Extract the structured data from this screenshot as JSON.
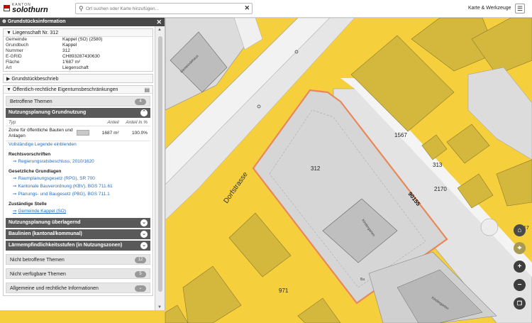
{
  "header": {
    "logo_kanton": "KANTON",
    "logo_name": "solothurn",
    "search_placeholder": "Ort suchen oder Karte hinzufügen...",
    "tools_label": "Karte & Werkzeuge"
  },
  "panel": {
    "title": "Grundstücksinformation",
    "parcel_header": "Liegenschaft Nr. 312",
    "parcel_rows": [
      {
        "k": "Gemeinde",
        "v": "Kappel (SO) (2580)"
      },
      {
        "k": "Grundbuch",
        "v": "Kappel"
      },
      {
        "k": "Nummer",
        "v": "312"
      },
      {
        "k": "E-GRID",
        "v": "CH893287430630"
      },
      {
        "k": "Fläche",
        "v": "1'687 m²"
      },
      {
        "k": "Art",
        "v": "Liegenschaft"
      }
    ],
    "grundstueckbeschrieb": "Grundstückbeschrieb",
    "oereb_title": "Öffentlich-rechtliche Eigentumsbeschränkungen",
    "betroffene_label": "Betroffene Themen",
    "betroffene_count": "4",
    "nutzung_title": "Nutzungsplanung Grundnutzung",
    "legend_header": {
      "typ": "Typ",
      "anteil": "Anteil",
      "anteil_pct": "Anteil in %"
    },
    "legend_row": {
      "label": "Zone für öffentliche Bauten und Anlagen",
      "area": "1687 m²",
      "pct": "100.0%"
    },
    "legend_link": "Vollständige Legende einblenden",
    "rechtsvorschriften_title": "Rechtsvorschriften",
    "rechtsvorschriften": [
      "Regierungsratsbeschluss, 2010/1620"
    ],
    "grundlagen_title": "Gesetzliche Grundlagen",
    "grundlagen": [
      "Raumplanungsgesetz (RPG), SR 700",
      "Kantonale Bauverordnung (KBV), BGS 711.61",
      "Planungs- und Baugesetz (PBG), BGS 711.1"
    ],
    "stelle_title": "Zuständige Stelle",
    "stelle": "Gemeinde Kappel (SO)",
    "other_themes": [
      "Nutzungsplanung überlagernd",
      "Baulinien (kantonal/kommunal)",
      "Lärmempfindlichkeitsstufen (in Nutzungszonen)"
    ],
    "nicht_betroffene_label": "Nicht betroffene Themen",
    "nicht_betroffene_count": "12",
    "nicht_verfuegbar_label": "Nicht verfügbare Themen",
    "nicht_verfuegbar_count": "5",
    "allgemein_label": "Allgemeine und rechtliche Informationen"
  },
  "map": {
    "street_dorf": "Dorfstrasse",
    "street_code": "90155",
    "parcels": [
      "312",
      "1567",
      "313",
      "2170",
      "971"
    ],
    "building_labels": [
      "Gemeindehaus",
      "Kindergarten",
      "Kindergarten"
    ],
    "small_label": "Ba",
    "edge_label": "17"
  },
  "colors": {
    "parcel_yellow": "#f7d74a",
    "building_fill": "#d3b83d",
    "selected_outline": "#e8875a",
    "panel_header": "#474747"
  }
}
